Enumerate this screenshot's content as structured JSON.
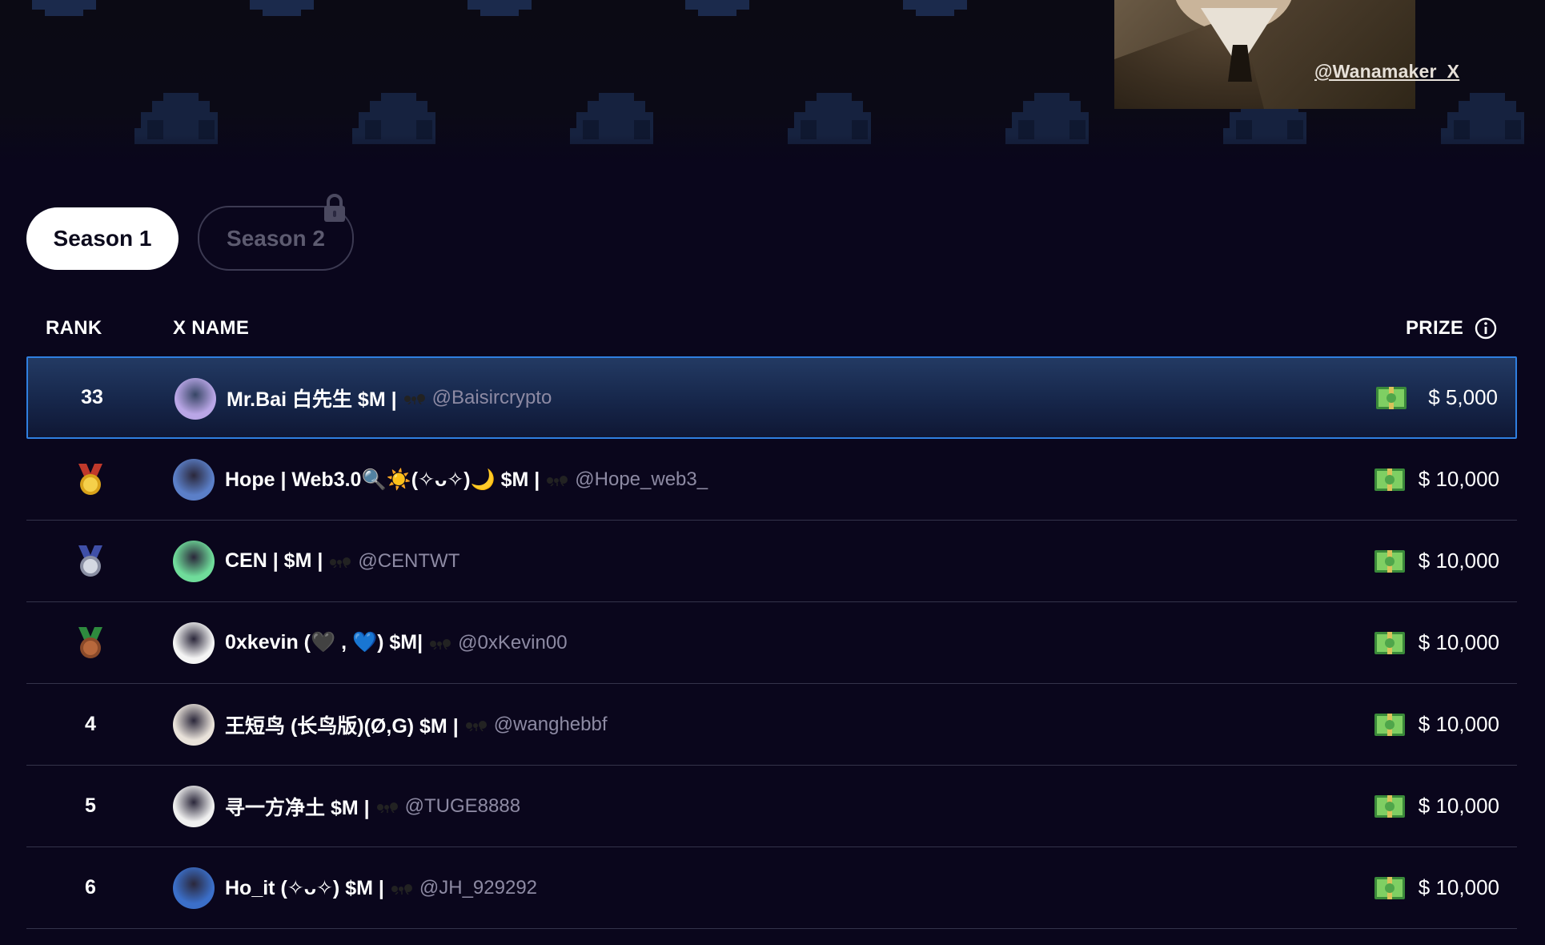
{
  "banner": {
    "handle_link": "@Wanamaker_X"
  },
  "tabs": [
    {
      "label": "Season 1",
      "active": true,
      "locked": false
    },
    {
      "label": "Season 2",
      "active": false,
      "locked": true
    }
  ],
  "table": {
    "headers": {
      "rank": "RANK",
      "name": "X NAME",
      "prize": "PRIZE"
    },
    "rows": [
      {
        "rank": "33",
        "medal": null,
        "name": "Mr.Bai 白先生 $M |",
        "handle": "@Baisircrypto",
        "prize": "$ 5,000",
        "avatar_color": "#b9a6e6",
        "highlight": true
      },
      {
        "rank": "1",
        "medal": "gold-medal-icon",
        "name": "Hope | Web3.0🔍☀️(✧ᴗ✧)🌙 $M |",
        "handle": "@Hope_web3_",
        "prize": "$ 10,000",
        "avatar_color": "#5b7fc8",
        "highlight": false
      },
      {
        "rank": "2",
        "medal": "silver-medal-icon",
        "name": "CEN | $M |",
        "handle": "@CENTWT",
        "prize": "$ 10,000",
        "avatar_color": "#6fdc9a",
        "highlight": false
      },
      {
        "rank": "3",
        "medal": "bronze-medal-icon",
        "name": "0xkevin (🖤 , 💙) $M|",
        "handle": "@0xKevin00",
        "prize": "$ 10,000",
        "avatar_color": "#f4f4f4",
        "highlight": false
      },
      {
        "rank": "4",
        "medal": null,
        "name": "王短鸟 (长鸟版)(Ø,G) $M |",
        "handle": "@wanghebbf",
        "prize": "$ 10,000",
        "avatar_color": "#e9e2da",
        "highlight": false
      },
      {
        "rank": "5",
        "medal": null,
        "name": "寻一方净土 $M |",
        "handle": "@TUGE8888",
        "prize": "$ 10,000",
        "avatar_color": "#efefef",
        "highlight": false
      },
      {
        "rank": "6",
        "medal": null,
        "name": "Ho_it (✧ᴗ✧) $M |",
        "handle": "@JH_929292",
        "prize": "$ 10,000",
        "avatar_color": "#3b6fc9",
        "highlight": false
      }
    ]
  },
  "colors": {
    "background": "#0a061c",
    "highlight_border": "#2f7fe0",
    "handle_text": "#8d8aa3"
  }
}
